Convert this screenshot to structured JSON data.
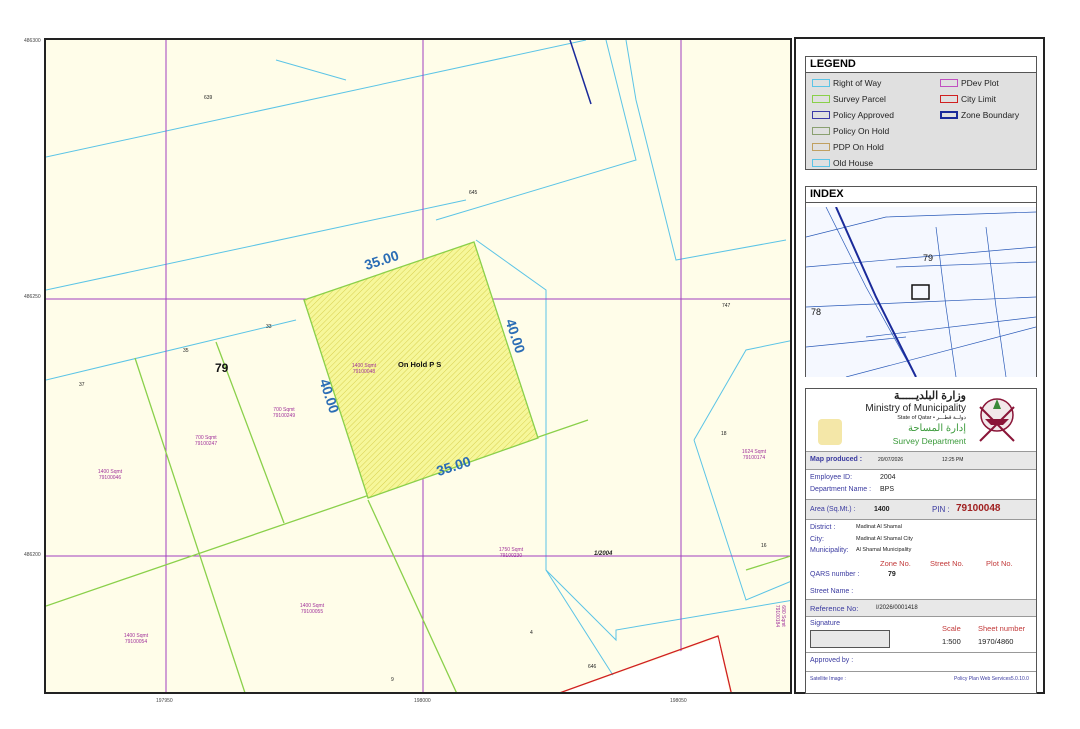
{
  "map": {
    "coords": {
      "top_left": "486300",
      "y_middle": "486250",
      "y_bottom": "486200",
      "x_left": "197950",
      "x_middle": "198000",
      "x_right": "198050"
    },
    "dimensions": {
      "top": "35.00",
      "bottom": "35.00",
      "left": "40.00",
      "right": "40.00"
    },
    "zone_label": "79",
    "on_hold_label": "On Hold P S",
    "reference_text": "1/2004",
    "plot_numbers": {
      "p639": "639",
      "p645": "645",
      "p747": "747",
      "p33": "33",
      "p35": "35",
      "p37": "37",
      "p18": "18",
      "p16": "16",
      "p4": "4",
      "p9": "9",
      "p646": "646"
    },
    "plots": [
      {
        "area": "1400 Sqmt",
        "pin": "79100048"
      },
      {
        "area": "700 Sqmt",
        "pin": "79100249"
      },
      {
        "area": "700 Sqmt",
        "pin": "79100247"
      },
      {
        "area": "1400 Sqmt",
        "pin": "79100046"
      },
      {
        "area": "1624 Sqmt",
        "pin": "79100174"
      },
      {
        "area": "1750 Sqmt",
        "pin": "79100230"
      },
      {
        "area": "1400 Sqmt",
        "pin": "79100055"
      },
      {
        "area": "1400 Sqmt",
        "pin": "79100054"
      },
      {
        "area": "680 Sqmt",
        "pin": "79100184"
      }
    ]
  },
  "legend": {
    "title": "LEGEND",
    "items_left": [
      {
        "label": "Right of Way",
        "color": "#5bc4e6"
      },
      {
        "label": "Survey Parcel",
        "color": "#8ad04a"
      },
      {
        "label": "Policy Approved",
        "color": "#3a3aa8"
      },
      {
        "label": "Policy On Hold",
        "color": "#8aa070"
      },
      {
        "label": "PDP On Hold",
        "color": "#c0a060"
      },
      {
        "label": "Old House",
        "color": "#5bc4e6"
      }
    ],
    "items_right": [
      {
        "label": "PDev Plot",
        "color": "#c050c0"
      },
      {
        "label": "City Limit",
        "color": "#d02020"
      },
      {
        "label": "Zone Boundary",
        "color": "#1a2a9a"
      }
    ]
  },
  "index": {
    "title": "INDEX",
    "zone_a": "79",
    "zone_b": "78"
  },
  "ministry": {
    "arabic_name": "وزارة البلديـــــة",
    "english_name": "Ministry of Municipality",
    "state_line": "State of Qatar • دولــة قطـــر",
    "arabic_dept": "إدارة المساحة",
    "english_dept": "Survey Department"
  },
  "details": {
    "map_produced_label": "Map produced :",
    "map_produced_date": "20/07/2026",
    "map_produced_time": "12:25 PM",
    "employee_id_label": "Employee ID:",
    "employee_id": "2004",
    "department_label": "Department Name :",
    "department": "BPS",
    "area_label": "Area (Sq.Mt.) :",
    "area": "1400",
    "pin_label": "PIN :",
    "pin": "79100048",
    "district_label": "District :",
    "district": "Madinat Al Shamal",
    "city_label": "City:",
    "city": "Madinat Al Shamal City",
    "municipality_label": "Municipality:",
    "municipality": "Al Shamal Municipality",
    "zone_no_label": "Zone No.",
    "street_no_label": "Street No.",
    "plot_no_label": "Plot No.",
    "qars_label": "QARS number :",
    "qars_zone": "79",
    "street_name_label": "Street Name :",
    "reference_label": "Reference No:",
    "reference": "I/2026/0001418",
    "signature_label": "Signature",
    "scale_label": "Scale",
    "scale": "1:500",
    "sheet_label": "Sheet number",
    "sheet": "1970/4860",
    "approved_label": "Approved by :",
    "satellite_label": "Satellite Image :",
    "service_label": "Policy Plan Web Services5.0.10.0"
  }
}
